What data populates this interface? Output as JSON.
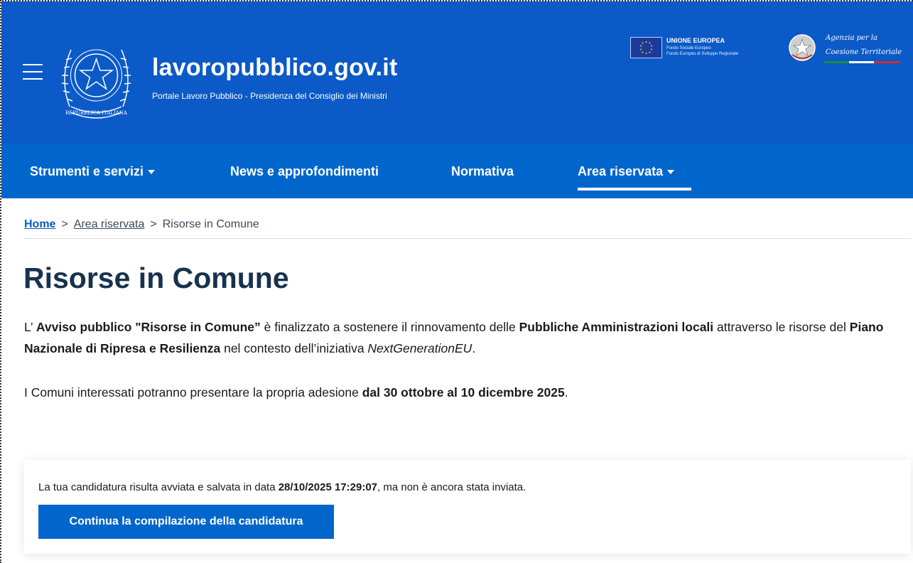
{
  "colors": {
    "header_bg": "#0b5ac7",
    "nav_bg": "#0066cc",
    "title_color": "#17324d",
    "button_bg": "#0066cc"
  },
  "header": {
    "title": "lavoropubblico.gov.it",
    "subtitle": "Portale Lavoro Pubblico - Presidenza del Consiglio dei Ministri",
    "emblem_text": "REPUBBLICA ITALIANA",
    "eu": {
      "title": "UNIONE EUROPEA",
      "line1": "Fondo Sociale Europeo",
      "line2": "Fondo Europeo di Sviluppo Regionale"
    },
    "agency": {
      "line1": "Agenzia per la",
      "line2": "Coesione Territoriale"
    }
  },
  "nav": {
    "items": [
      {
        "label": "Strumenti e servizi"
      },
      {
        "label": "News e approfondimenti"
      },
      {
        "label": "Normativa"
      },
      {
        "label": "Area riservata"
      }
    ]
  },
  "breadcrumb": {
    "home": "Home",
    "item1": "Area riservata",
    "current": "Risorse in Comune",
    "separator": ">"
  },
  "main": {
    "title": "Risorse in Comune",
    "p1": {
      "a": "L’ ",
      "b": "Avviso pubblico \"Risorse in Comune”",
      "c": " è finalizzato a sostenere il rinnovamento delle ",
      "d": "Pubbliche Amministrazioni locali",
      "e": " attraverso le risorse del ",
      "f": "Piano Nazionale di Ripresa e Resilienza",
      "g": " nel contesto dell’iniziativa ",
      "h": "NextGenerationEU",
      "i": "."
    },
    "p2": {
      "a": "I Comuni interessati potranno presentare la propria adesione ",
      "b": "dal 30 ottobre al 10 dicembre 2025",
      "c": "."
    }
  },
  "card": {
    "text_a": "La tua candidatura risulta avviata e salvata in data ",
    "text_b": "28/10/2025 17:29:07",
    "text_c": ", ma non è ancora stata inviata.",
    "button": "Continua la compilazione della candidatura"
  }
}
